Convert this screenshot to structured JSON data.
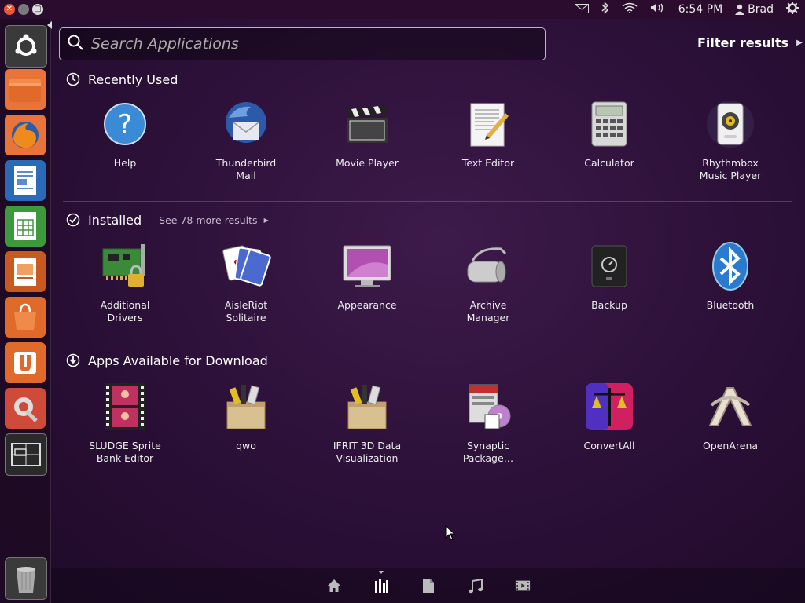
{
  "colors": {
    "panel": "#2b0c2e",
    "accent_orange": "#e9572f",
    "text": "#ffffff"
  },
  "window_controls": {
    "close": "✕",
    "minimize": "–",
    "maximize": "▢"
  },
  "top_panel": {
    "time": "6:54 PM",
    "user": "Brad"
  },
  "search": {
    "placeholder": "Search Applications",
    "value": ""
  },
  "filter": {
    "label": "Filter results"
  },
  "launcher": {
    "items": [
      {
        "name": "dash-home-icon"
      },
      {
        "name": "files-icon"
      },
      {
        "name": "firefox-icon"
      },
      {
        "name": "writer-icon"
      },
      {
        "name": "calc-icon"
      },
      {
        "name": "impress-icon"
      },
      {
        "name": "software-center-icon"
      },
      {
        "name": "ubuntu-one-icon"
      },
      {
        "name": "system-settings-icon"
      },
      {
        "name": "workspace-switcher-icon"
      },
      {
        "name": "trash-icon"
      }
    ]
  },
  "categories": {
    "recent": {
      "title": "Recently Used",
      "apps": [
        {
          "label": "Help"
        },
        {
          "label": "Thunderbird\nMail"
        },
        {
          "label": "Movie Player"
        },
        {
          "label": "Text Editor"
        },
        {
          "label": "Calculator"
        },
        {
          "label": "Rhythmbox\nMusic Player"
        }
      ]
    },
    "installed": {
      "title": "Installed",
      "more": "See 78 more results",
      "apps": [
        {
          "label": "Additional\nDrivers"
        },
        {
          "label": "AisleRiot\nSolitaire"
        },
        {
          "label": "Appearance"
        },
        {
          "label": "Archive\nManager"
        },
        {
          "label": "Backup"
        },
        {
          "label": "Bluetooth"
        }
      ]
    },
    "download": {
      "title": "Apps Available for Download",
      "apps": [
        {
          "label": "SLUDGE Sprite\nBank Editor"
        },
        {
          "label": "qwo"
        },
        {
          "label": "IFRIT 3D Data\nVisualization"
        },
        {
          "label": "Synaptic\nPackage…"
        },
        {
          "label": "ConvertAll"
        },
        {
          "label": "OpenArena"
        }
      ]
    }
  },
  "lenses": [
    "home-lens",
    "applications-lens",
    "files-lens",
    "music-lens",
    "video-lens"
  ]
}
